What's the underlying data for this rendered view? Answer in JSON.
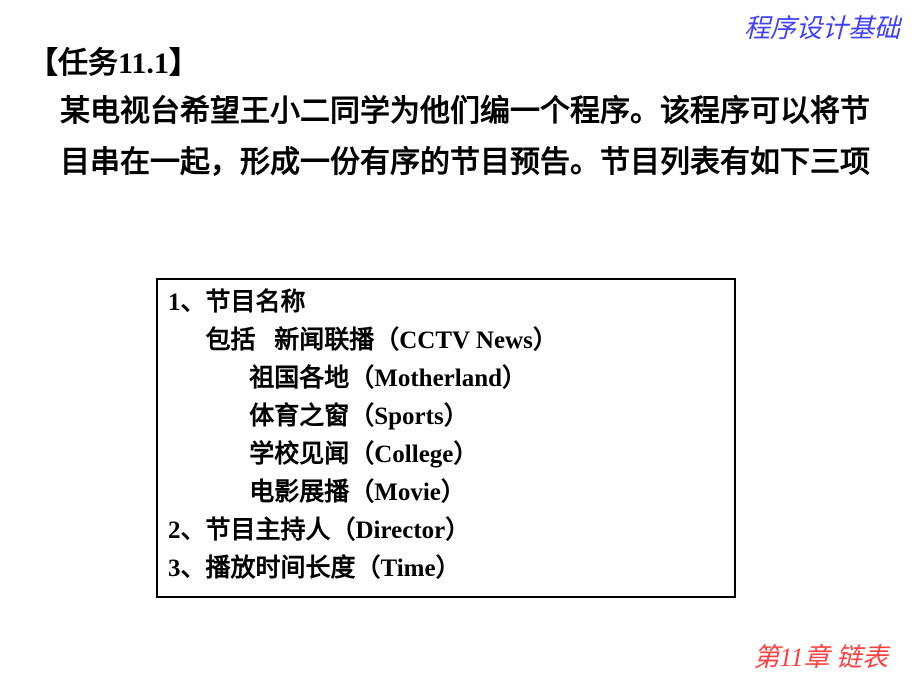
{
  "header": "程序设计基础",
  "task_title": "【任务11.1】",
  "task_desc": "某电视台希望王小二同学为他们编一个程序。该程序可以将节目串在一起，形成一份有序的节目预告。节目列表有如下三项",
  "box": {
    "line1": "1、节目名称",
    "line2": "      包括   新闻联播（CCTV News）",
    "line3": "             祖国各地（Motherland）",
    "line4": "             体育之窗（Sports）",
    "line5": "             学校见闻（College）",
    "line6": "             电影展播（Movie）",
    "line7": "2、节目主持人（Director）",
    "line8": "3、播放时间长度（Time）"
  },
  "footer": "第11章    链表"
}
